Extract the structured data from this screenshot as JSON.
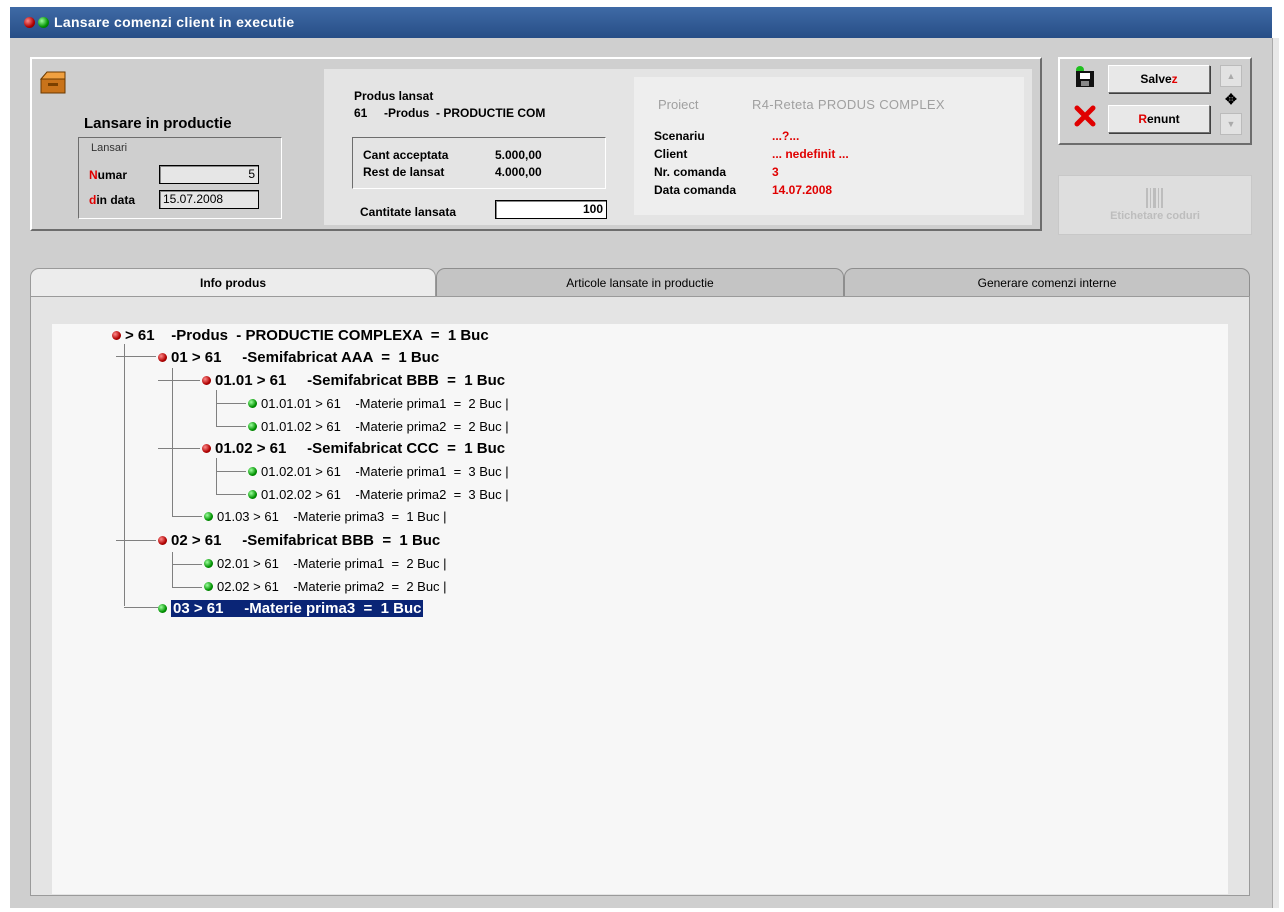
{
  "window": {
    "title": "Lansare comenzi client in executie"
  },
  "header": {
    "section_title": "Lansare in productie",
    "group_label": "Lansari",
    "numar_label_prefix": "N",
    "numar_label_rest": "umar",
    "numar_value": "5",
    "data_label_prefix": "d",
    "data_label_rest": "in data",
    "data_value": "15.07.2008"
  },
  "product": {
    "label": "Produs lansat",
    "line": "61     -Produs  - PRODUCTIE COM",
    "cant_acceptata_label": "Cant acceptata",
    "cant_acceptata_value": "5.000,00",
    "rest_label": "Rest de lansat",
    "rest_value": "4.000,00",
    "cantitate_label": "Cantitate lansata",
    "cantitate_value": "100"
  },
  "project": {
    "proiect_label": "Proiect",
    "proiect_value": "R4-Reteta PRODUS COMPLEX",
    "scenariu_label": "Scenariu",
    "scenariu_value": "...?...",
    "client_label": "Client",
    "client_value": "... nedefinit ...",
    "nr_comanda_label": "Nr. comanda",
    "nr_comanda_value": "3",
    "data_comanda_label": "Data comanda",
    "data_comanda_value": "14.07.2008"
  },
  "actions": {
    "save_prefix": "Salve",
    "save_hot": "z",
    "cancel_hot": "R",
    "cancel_rest": "enunt",
    "barcode_label": "Etichetare coduri"
  },
  "tabs": [
    {
      "label": "Info produs",
      "active": true
    },
    {
      "label": "Articole lansate in productie",
      "active": false
    },
    {
      "label": "Generare comenzi interne",
      "active": false
    }
  ],
  "tree": [
    {
      "text": "> 61    -Produs  - PRODUCTIE COMPLEXA  =  1 Buc",
      "bullet": "red",
      "size": "big"
    },
    {
      "text": "01 > 61     -Semifabricat AAA  =  1 Buc",
      "bullet": "red",
      "size": "big"
    },
    {
      "text": "01.01 > 61     -Semifabricat BBB  =  1 Buc",
      "bullet": "red",
      "size": "big"
    },
    {
      "text": "01.01.01 > 61    -Materie prima1  =  2 Buc |",
      "bullet": "green",
      "size": "small"
    },
    {
      "text": "01.01.02 > 61    -Materie prima2  =  2 Buc |",
      "bullet": "green",
      "size": "small"
    },
    {
      "text": "01.02 > 61     -Semifabricat CCC  =  1 Buc",
      "bullet": "red",
      "size": "big"
    },
    {
      "text": "01.02.01 > 61    -Materie prima1  =  3 Buc |",
      "bullet": "green",
      "size": "small"
    },
    {
      "text": "01.02.02 > 61    -Materie prima2  =  3 Buc |",
      "bullet": "green",
      "size": "small"
    },
    {
      "text": "01.03 > 61    -Materie prima3  =  1 Buc |",
      "bullet": "green",
      "size": "small"
    },
    {
      "text": "02 > 61     -Semifabricat BBB  =  1 Buc",
      "bullet": "red",
      "size": "big"
    },
    {
      "text": "02.01 > 61    -Materie prima1  =  2 Buc |",
      "bullet": "green",
      "size": "small"
    },
    {
      "text": "02.02 > 61    -Materie prima2  =  2 Buc |",
      "bullet": "green",
      "size": "small"
    },
    {
      "text": "03 > 61     -Materie prima3  =  1 Buc",
      "bullet": "green",
      "size": "big",
      "selected": true
    }
  ],
  "colors": {
    "titlebar": "#274e86",
    "accent_red": "#e00000",
    "selection": "#0a2576"
  }
}
